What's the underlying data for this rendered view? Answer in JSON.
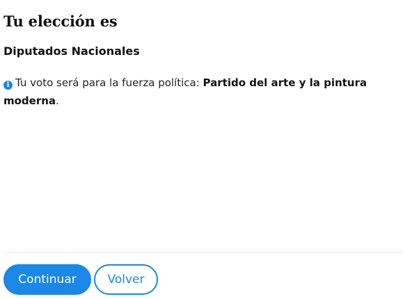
{
  "header": {
    "title": "Tu elección es",
    "subtitle": "Diputados Nacionales"
  },
  "info": {
    "icon": "info-circle-icon",
    "prefix": "Tu voto será para la fuerza política: ",
    "party": "Partido del arte y la pintura moderna",
    "suffix": "."
  },
  "actions": {
    "continue_label": "Continuar",
    "back_label": "Volver"
  },
  "colors": {
    "accent": "#1b87e6",
    "text": "#111111",
    "divider": "#e6e6e6"
  }
}
